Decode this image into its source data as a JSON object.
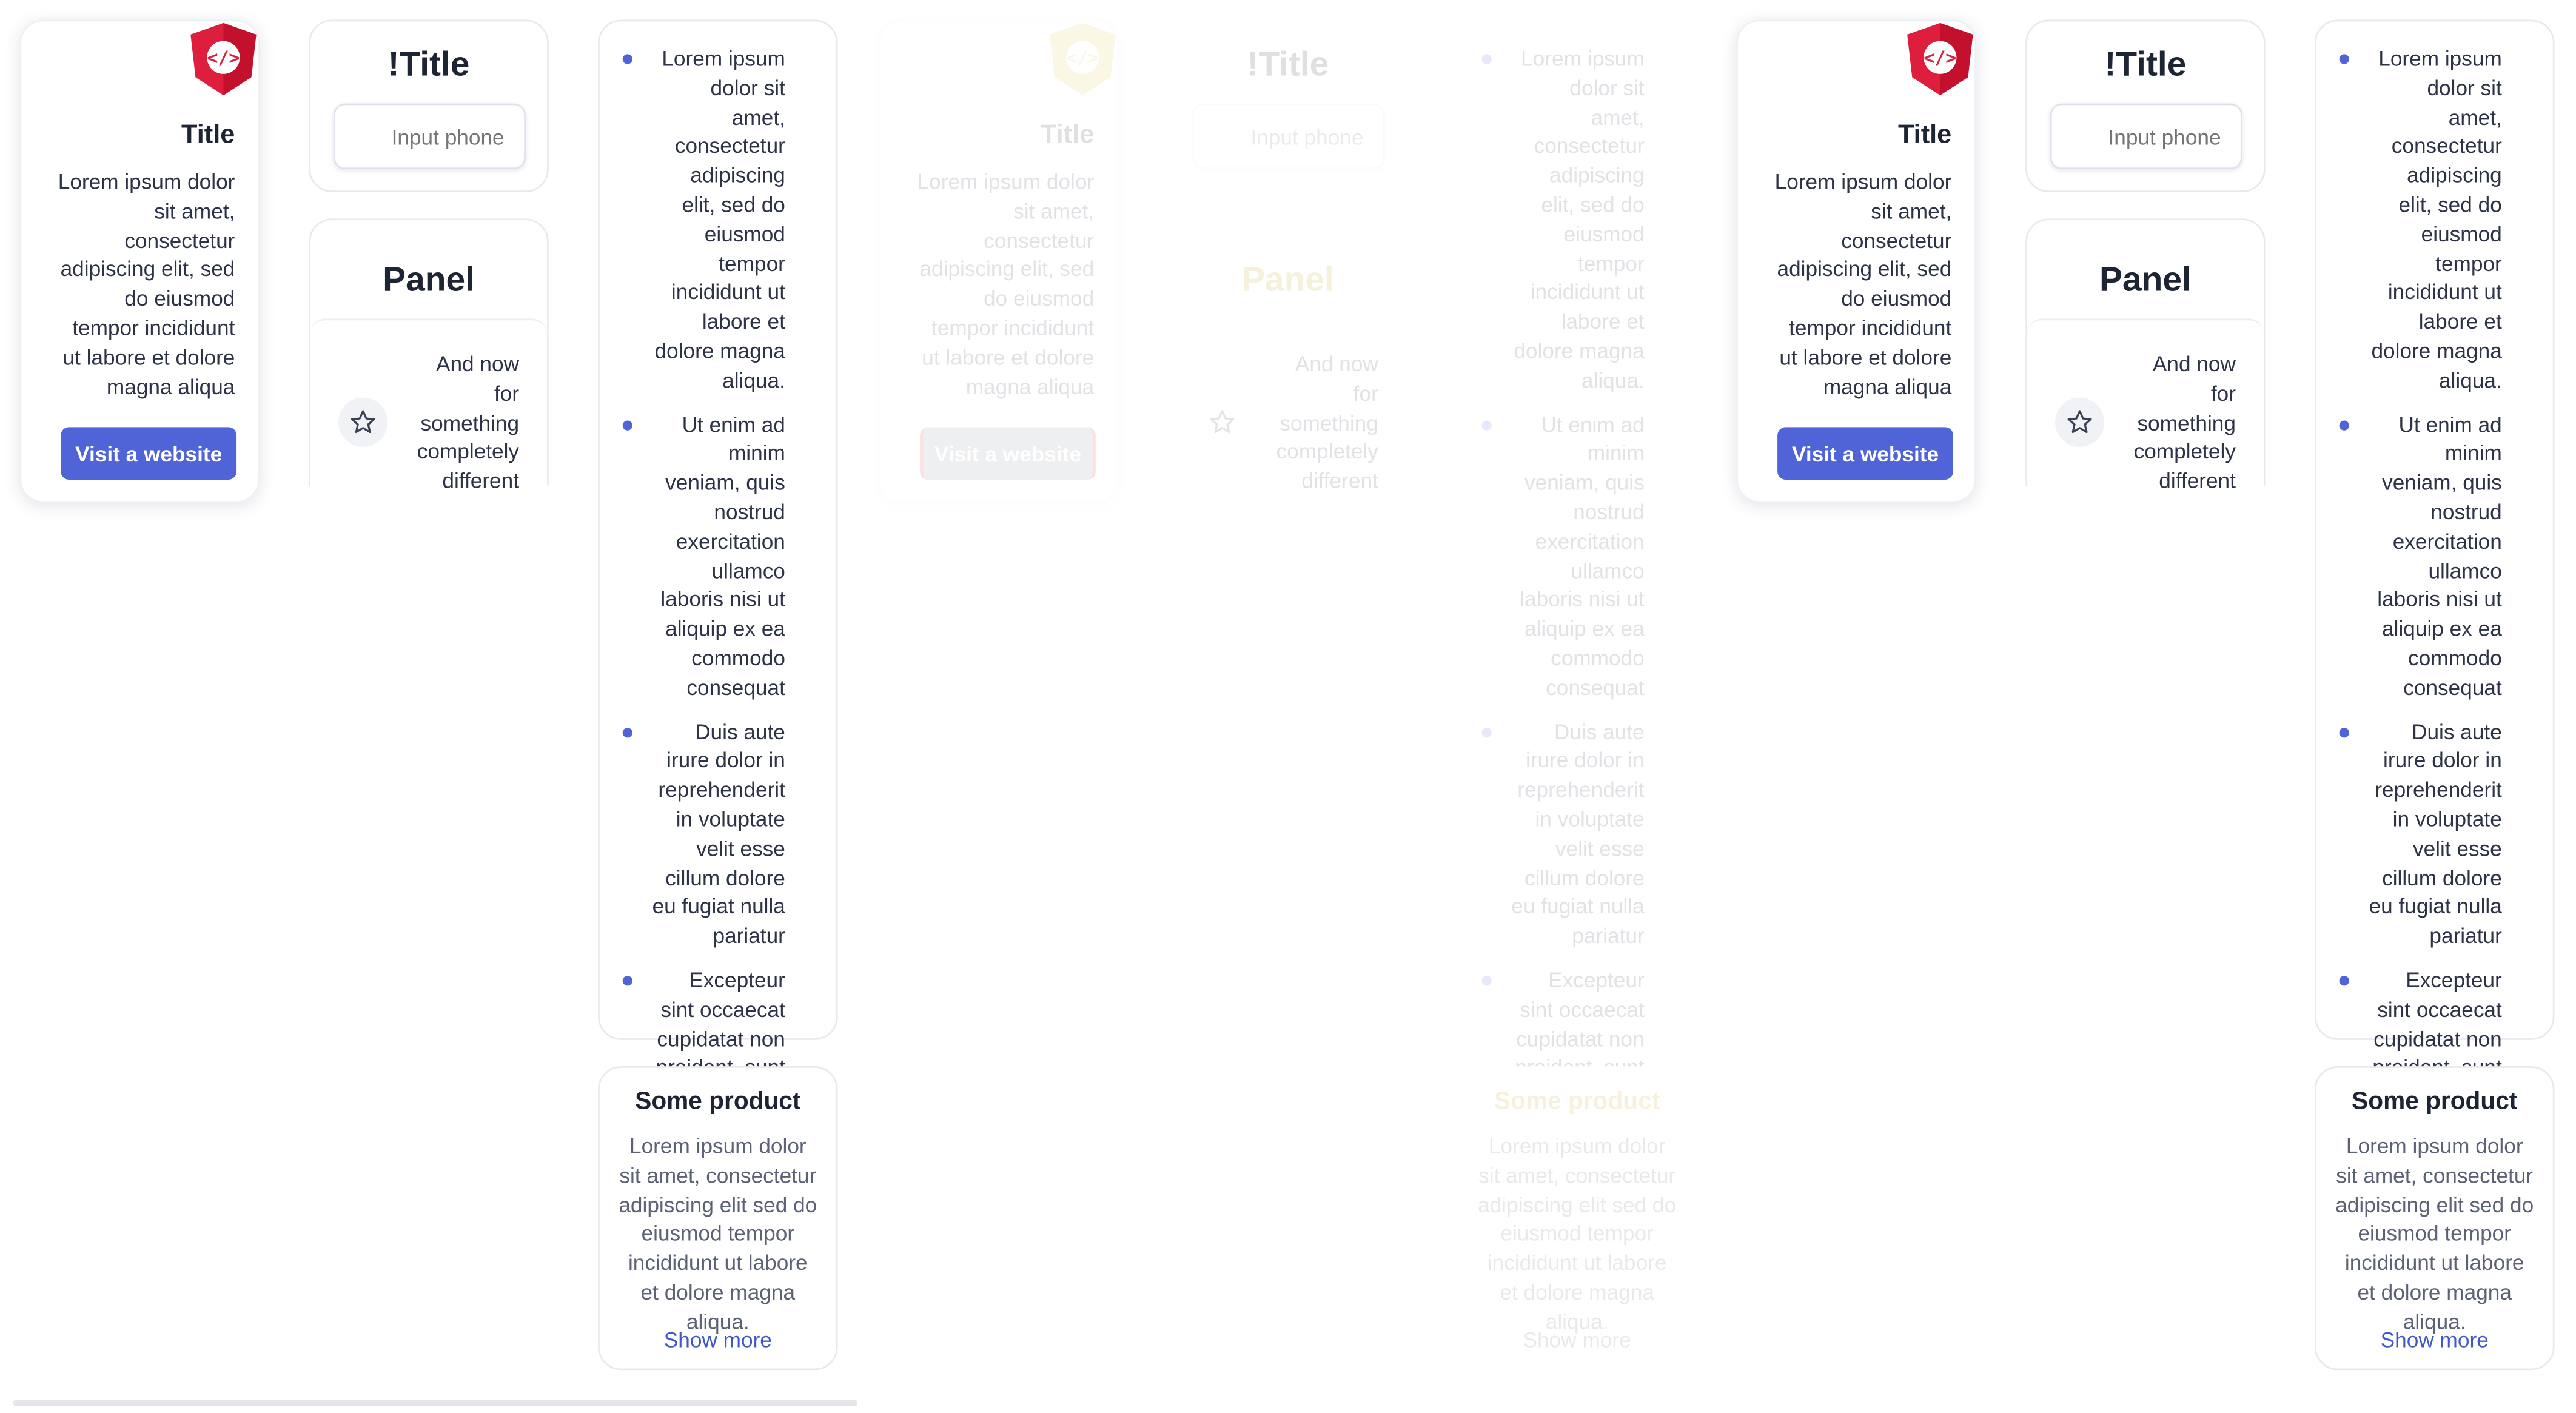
{
  "cards": {
    "logo_title": "Title",
    "logo_text": "Lorem ipsum dolor sit amet, consectetur adipiscing elit, sed do eiusmod tempor incididunt ut labore et dolore magna aliqua",
    "visit_button": "Visit a website",
    "input_title": "!Title",
    "input_placeholder": "Input phone",
    "panel_title": "Panel",
    "panel_text": "And now for something completely different",
    "list_items": [
      "Lorem ipsum dolor sit amet, consectetur adipiscing elit, sed do eiusmod tempor incididunt ut labore et dolore magna aliqua.",
      "Ut enim ad minim veniam, quis nostrud exercitation ullamco laboris nisi ut aliquip ex ea commodo consequat",
      "Duis aute irure dolor in reprehenderit in voluptate velit esse cillum dolore eu fugiat nulla pariatur",
      "Excepteur sint occaecat cupidatat non proident, sunt in culpa qui officia deserunt mollit anim id est laborum"
    ],
    "product_title": "Some product",
    "product_text": "Lorem ipsum dolor sit amet, consectetur adipiscing elit sed do eiusmod tempor incididunt ut labore et dolore magna aliqua.",
    "show_more": "Show more"
  },
  "icons": {
    "logo": "code-shield-icon",
    "star": "star-icon",
    "bullet": "bullet-icon"
  },
  "colors": {
    "accent": "#5064d8",
    "logo_red": "#dd1f3d",
    "faded_logo": "#e3c84a"
  }
}
